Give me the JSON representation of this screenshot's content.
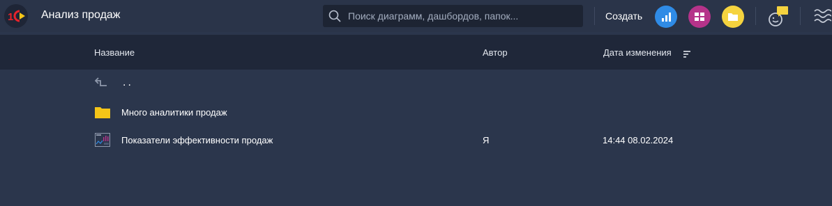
{
  "app": {
    "title": "Анализ продаж"
  },
  "search": {
    "placeholder": "Поиск диаграмм, дашбордов, папок..."
  },
  "toolbar": {
    "create_label": "Создать",
    "icons": [
      "chart-icon",
      "dashboard-icon",
      "folder-icon",
      "assistant-icon",
      "menu-icon"
    ]
  },
  "colors": {
    "topbar": "#2a3449",
    "header": "#1f2739",
    "body": "#2b364c",
    "chart_btn": "#2f8be6",
    "dashboard_btn": "#b5338a",
    "folder_btn": "#f5d33f",
    "logo_red": "#e8232b",
    "logo_yellow": "#f5c518"
  },
  "table": {
    "columns": {
      "name": "Название",
      "author": "Автор",
      "modified": "Дата изменения"
    },
    "parent_row": {
      "label": ".."
    },
    "rows": [
      {
        "icon": "folder-icon",
        "name": "Много аналитики продаж",
        "author": "",
        "modified": ""
      },
      {
        "icon": "dashboard-file-icon",
        "name": "Показатели эффективности продаж",
        "author": "Я",
        "modified": "14:44 08.02.2024"
      }
    ]
  }
}
